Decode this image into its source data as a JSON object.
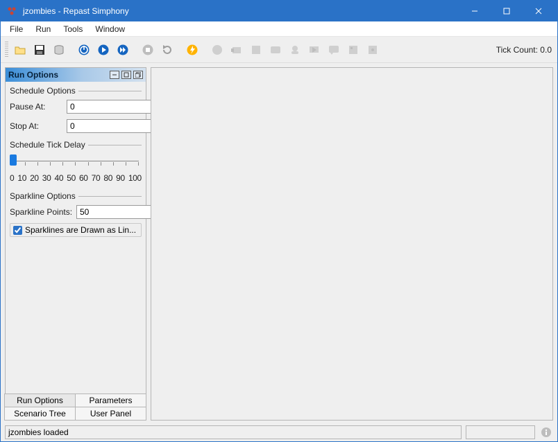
{
  "title": "jzombies - Repast Simphony",
  "menubar": [
    "File",
    "Run",
    "Tools",
    "Window"
  ],
  "toolbar": {
    "tick_label": "Tick Count: 0.0"
  },
  "panel": {
    "title": "Run Options",
    "schedule_section": "Schedule Options",
    "pause_label": "Pause At:",
    "pause_value": "0",
    "stop_label": "Stop At:",
    "stop_value": "0",
    "delay_section": "Schedule Tick Delay",
    "slider_labels": [
      "0",
      "10",
      "20",
      "30",
      "40",
      "50",
      "60",
      "70",
      "80",
      "90",
      "100"
    ],
    "sparkline_section": "Sparkline Options",
    "sparkline_points_label": "Sparkline Points:",
    "sparkline_points_value": "50",
    "sparkline_check_label": "Sparklines are Drawn as Lin...",
    "sparkline_checked": true
  },
  "tabs": [
    "Run Options",
    "Parameters",
    "Scenario Tree",
    "User Panel"
  ],
  "status": {
    "message": "jzombies loaded"
  }
}
